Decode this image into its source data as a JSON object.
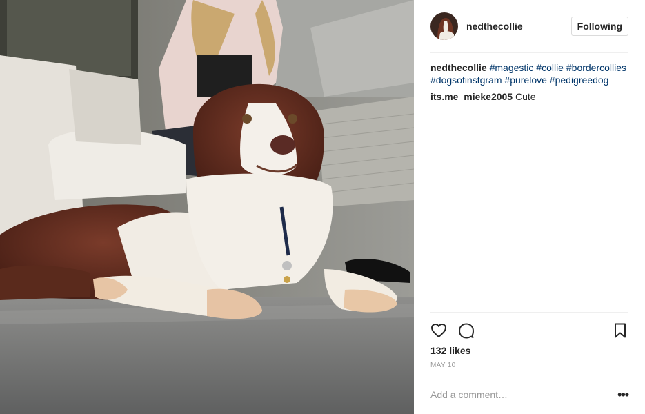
{
  "post": {
    "username": "nedthecollie",
    "follow_label": "Following",
    "caption": {
      "username": "nedthecollie",
      "tags": [
        "#magestic",
        "#collie",
        "#bordercollies",
        "#dogsofinstgram",
        "#purelove",
        "#pedigreedog"
      ]
    },
    "comments": [
      {
        "username": "its.me_mieke2005",
        "text": "Cute"
      }
    ],
    "likes": "132 likes",
    "date": "MAY 10",
    "add_comment_placeholder": "Add a comment…",
    "more_label": "•••",
    "icons": {
      "like": "heart-icon",
      "comment": "comment-bubble-icon",
      "save": "bookmark-icon",
      "more": "more-options-icon"
    },
    "colors": {
      "hashtag": "#003569",
      "text": "#262626",
      "muted": "#999999",
      "divider": "#efefef"
    }
  }
}
